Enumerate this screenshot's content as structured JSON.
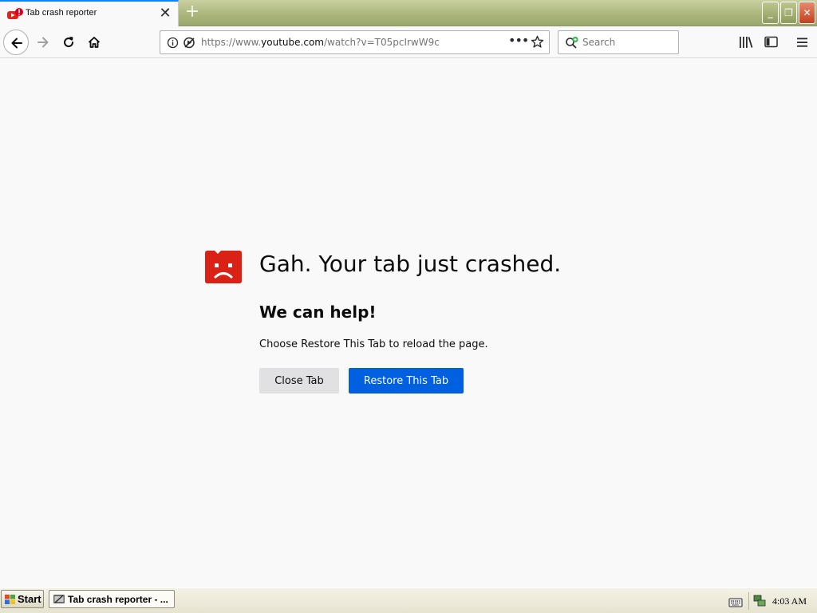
{
  "window": {
    "tab_title": "Tab crash reporter",
    "tab_close": "✕",
    "new_tab": "+",
    "controls": {
      "minimize": "_",
      "restore": "❐",
      "close": "✕"
    }
  },
  "toolbar": {
    "url_prefix": "https://www.",
    "url_domain": "youtube.com",
    "url_path": "/watch?v=T05pcIrwW9c",
    "page_actions": "•••",
    "search_placeholder": "Search"
  },
  "crash_page": {
    "title": "Gah. Your tab just crashed.",
    "subtitle": "We can help!",
    "message": "Choose Restore This Tab to reload the page.",
    "close_button": "Close Tab",
    "restore_button": "Restore This Tab"
  },
  "taskbar": {
    "start_label": "Start",
    "task_label": "Tab crash reporter - ...",
    "clock": "4:03 AM"
  },
  "colors": {
    "tab_accent": "#0a84ff",
    "primary_button": "#0060df",
    "crash_icon": "#d92215"
  }
}
